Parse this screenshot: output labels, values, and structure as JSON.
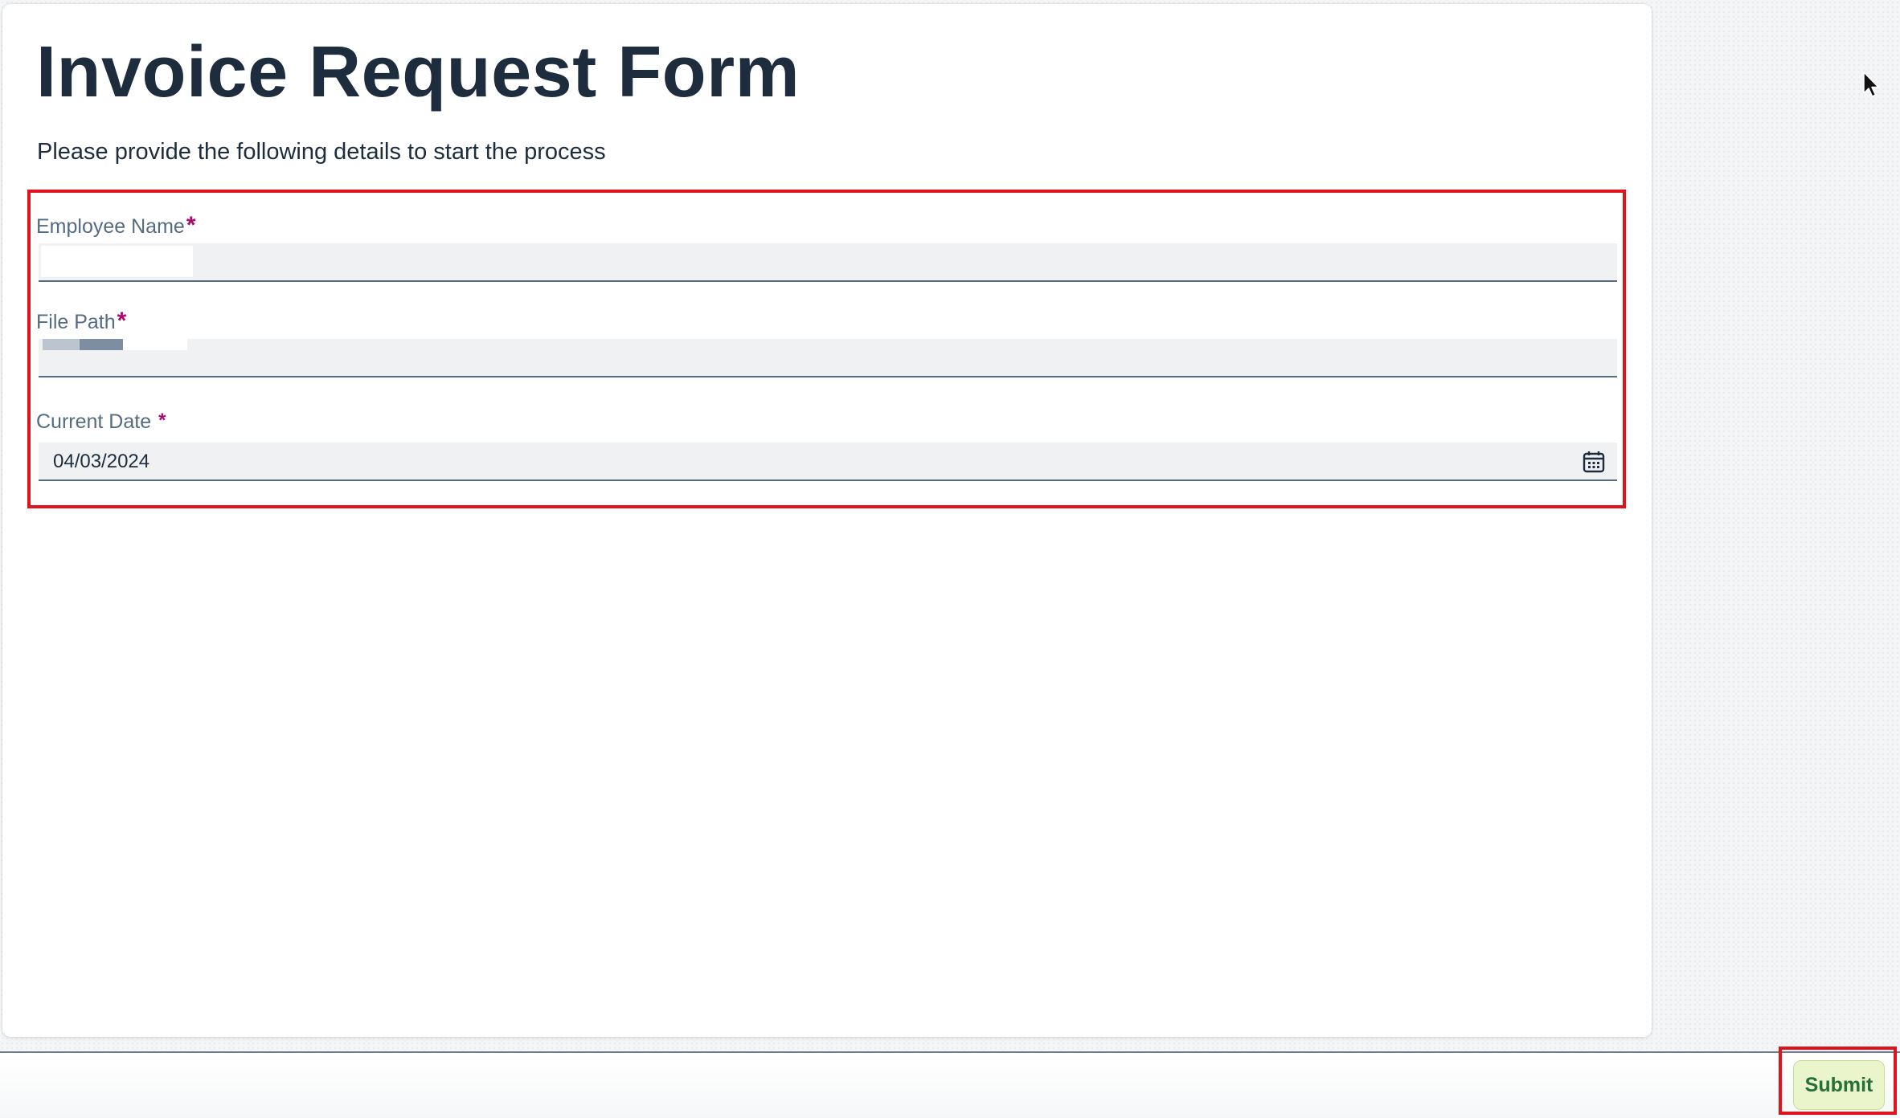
{
  "form": {
    "title": "Invoice Request Form",
    "subtitle": "Please provide the following details to start the process",
    "fields": [
      {
        "label": "Employee Name",
        "required_mark": "*",
        "value": ""
      },
      {
        "label": "File Path",
        "required_mark": "*",
        "value": ""
      },
      {
        "label": "Current Date",
        "required_mark": "*",
        "value": "04/03/2024"
      }
    ]
  },
  "footer": {
    "submit_label": "Submit"
  },
  "icons": {
    "date_picker": "calendar-icon",
    "pointer": "mouse-cursor-icon"
  },
  "colors": {
    "highlight": "#e0121c",
    "required": "#aa0a6e",
    "submit_background": "#ebf5cb",
    "submit_text": "#256f3a",
    "title_text": "#1d2d3e",
    "label_text": "#556b82"
  }
}
